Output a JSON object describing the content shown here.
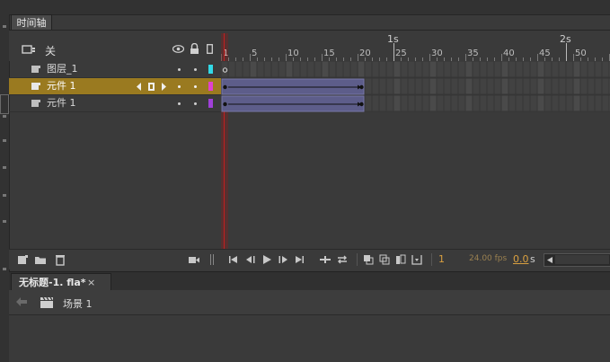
{
  "panel": {
    "tab_label": "时间轴"
  },
  "header": {
    "scene_label": "关",
    "eye_icon": "eye-icon",
    "lock_icon": "lock-icon",
    "outline_icon": "outline-icon"
  },
  "ruler": {
    "frame_numbers": [
      "1",
      "5",
      "10",
      "15",
      "20",
      "25",
      "30",
      "35",
      "40",
      "45",
      "50"
    ],
    "seconds_labels": [
      "1s",
      "2s"
    ]
  },
  "layers": [
    {
      "name": "图层_1",
      "color": "#32d9e6",
      "selected": false
    },
    {
      "name": "元件 1",
      "color": "#e040d0",
      "selected": true
    },
    {
      "name": "元件 1",
      "color": "#a040d8",
      "selected": false
    }
  ],
  "colors": {
    "playhead": "#b02020",
    "selected_row": "#9a7a20",
    "tween_span": "#5d5d8a",
    "fps_color": "#d9a040"
  },
  "toolbar": {
    "current_frame": "1",
    "fps": "24.00 fps",
    "time_value": "0.0",
    "time_unit": "s"
  },
  "document": {
    "tab_label": "无标题-1. fla*",
    "close_glyph": "×",
    "scene_name": "场景 1"
  }
}
